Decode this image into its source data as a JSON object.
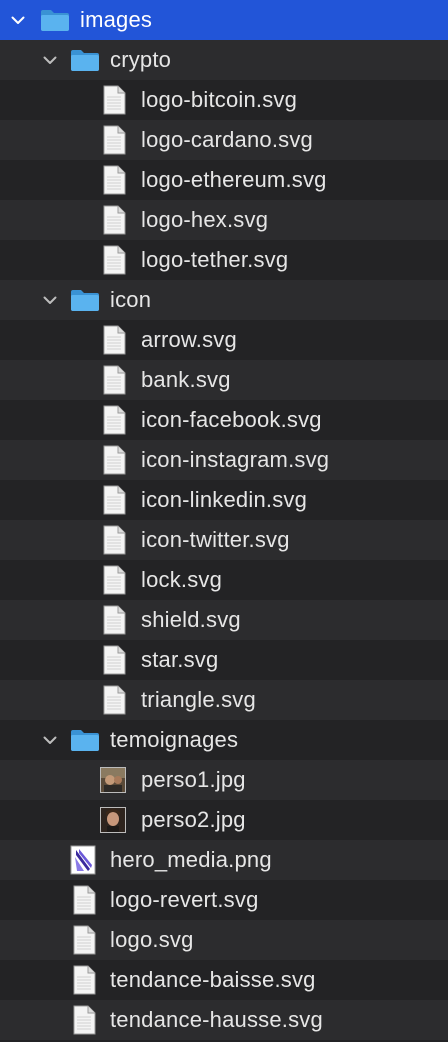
{
  "tree": [
    {
      "label": "images",
      "kind": "folder",
      "icon": "folder-icon",
      "level": 0,
      "expanded": true,
      "selected": true
    },
    {
      "label": "crypto",
      "kind": "folder",
      "icon": "folder-icon",
      "level": 1,
      "expanded": true
    },
    {
      "label": "logo-bitcoin.svg",
      "kind": "file",
      "icon": "svg-file-icon",
      "level": 2
    },
    {
      "label": "logo-cardano.svg",
      "kind": "file",
      "icon": "svg-file-icon",
      "level": 2
    },
    {
      "label": "logo-ethereum.svg",
      "kind": "file",
      "icon": "svg-file-icon",
      "level": 2
    },
    {
      "label": "logo-hex.svg",
      "kind": "file",
      "icon": "svg-file-icon",
      "level": 2
    },
    {
      "label": "logo-tether.svg",
      "kind": "file",
      "icon": "svg-file-icon",
      "level": 2
    },
    {
      "label": "icon",
      "kind": "folder",
      "icon": "folder-icon",
      "level": 1,
      "expanded": true
    },
    {
      "label": "arrow.svg",
      "kind": "file",
      "icon": "svg-file-icon",
      "level": 2
    },
    {
      "label": "bank.svg",
      "kind": "file",
      "icon": "svg-file-icon",
      "level": 2
    },
    {
      "label": "icon-facebook.svg",
      "kind": "file",
      "icon": "svg-file-icon",
      "level": 2
    },
    {
      "label": "icon-instagram.svg",
      "kind": "file",
      "icon": "svg-file-icon",
      "level": 2
    },
    {
      "label": "icon-linkedin.svg",
      "kind": "file",
      "icon": "svg-file-icon",
      "level": 2
    },
    {
      "label": "icon-twitter.svg",
      "kind": "file",
      "icon": "svg-file-icon",
      "level": 2
    },
    {
      "label": "lock.svg",
      "kind": "file",
      "icon": "svg-file-icon",
      "level": 2
    },
    {
      "label": "shield.svg",
      "kind": "file",
      "icon": "svg-file-icon",
      "level": 2
    },
    {
      "label": "star.svg",
      "kind": "file",
      "icon": "svg-file-icon",
      "level": 2
    },
    {
      "label": "triangle.svg",
      "kind": "file",
      "icon": "svg-file-icon",
      "level": 2
    },
    {
      "label": "temoignages",
      "kind": "folder",
      "icon": "folder-icon",
      "level": 1,
      "expanded": true
    },
    {
      "label": "perso1.jpg",
      "kind": "image",
      "icon": "photo-thumbnail-icon",
      "level": 2
    },
    {
      "label": "perso2.jpg",
      "kind": "image",
      "icon": "photo-thumbnail-icon",
      "level": 2
    },
    {
      "label": "hero_media.png",
      "kind": "image",
      "icon": "png-thumbnail-icon",
      "level": 1
    },
    {
      "label": "logo-revert.svg",
      "kind": "file",
      "icon": "svg-file-icon",
      "level": 1
    },
    {
      "label": "logo.svg",
      "kind": "file",
      "icon": "svg-file-icon",
      "level": 1
    },
    {
      "label": "tendance-baisse.svg",
      "kind": "file",
      "icon": "svg-file-icon",
      "level": 1
    },
    {
      "label": "tendance-hausse.svg",
      "kind": "file",
      "icon": "svg-file-icon",
      "level": 1
    }
  ],
  "colors": {
    "selection": "#2255d8",
    "folder": "#5ab3ef",
    "row_alt": "#2c2c2e",
    "row_base": "#232325",
    "text": "#e6e6e6"
  }
}
